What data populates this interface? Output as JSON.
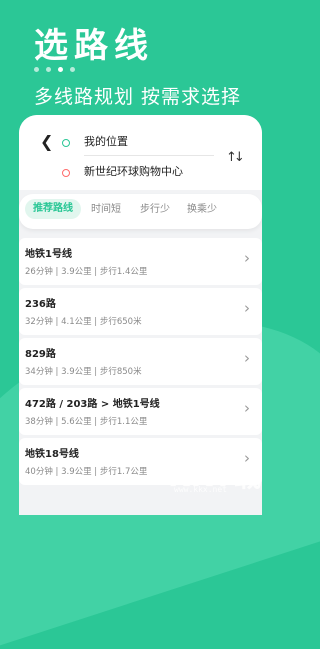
{
  "hero": {
    "title": "选路线",
    "subtitle": "多线路规划 按需求选择",
    "dots": [
      false,
      false,
      true,
      false
    ]
  },
  "search": {
    "back_icon": "arrow-left-icon",
    "from": "我的位置",
    "to": "新世纪环球购物中心",
    "swap_icon": "swap-vertical-icon",
    "colors": {
      "from_ring": "#2bc796",
      "to_ring": "#ff6b6b"
    }
  },
  "tabs": [
    {
      "label": "推荐路线",
      "active": true
    },
    {
      "label": "时间短",
      "active": false
    },
    {
      "label": "步行少",
      "active": false
    },
    {
      "label": "换乘少",
      "active": false
    }
  ],
  "routes": [
    {
      "name": "地铁1号线",
      "meta": "26分钟 | 3.9公里 | 步行1.4公里"
    },
    {
      "name": "236路",
      "meta": "32分钟 | 4.1公里 | 步行650米"
    },
    {
      "name": "829路",
      "meta": "34分钟 | 3.9公里 | 步行850米"
    },
    {
      "name": "472路 / 203路 > 地铁1号线",
      "meta": "38分钟 | 5.6公里 | 步行1.1公里"
    },
    {
      "name": "地铁18号线",
      "meta": "40分钟 | 3.9公里 | 步行1.7公里"
    }
  ],
  "watermark": {
    "text": "KKT载",
    "url": "www.kkx.net"
  },
  "theme": {
    "accent": "#2bc796",
    "accent_light": "#e1f6ee"
  }
}
